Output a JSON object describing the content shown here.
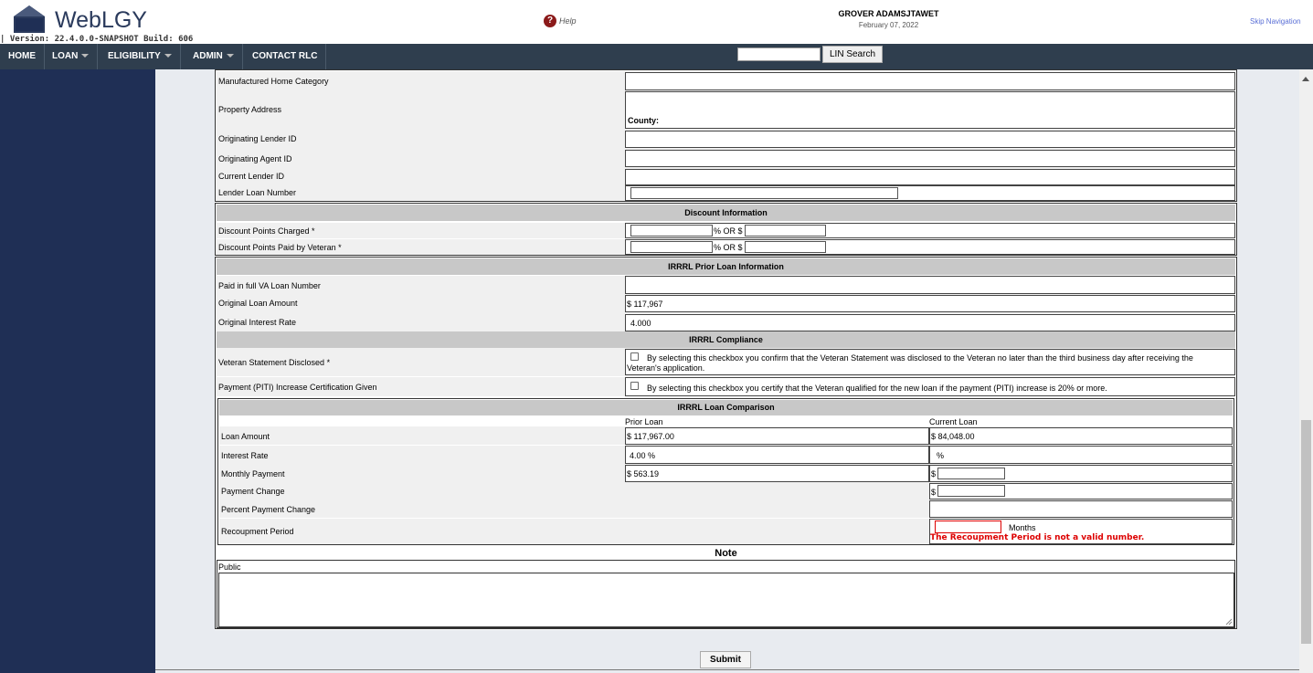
{
  "header": {
    "logo_text": "WebLGY",
    "version": "| Version: 22.4.0.0-SNAPSHOT Build: 606",
    "help_label": "Help",
    "user_name": "GROVER ADAMSJTAWET",
    "date": "February 07, 2022",
    "skip_nav": "Skip Navigation"
  },
  "nav": {
    "items": [
      "HOME",
      "LOAN",
      "ELIGIBILITY",
      "ADMIN",
      "CONTACT RLC"
    ],
    "search_button": "LIN Search"
  },
  "loan_info": {
    "manufactured_home_category": "Manufactured Home Category",
    "property_address": "Property Address",
    "county_label": "County:",
    "originating_lender_id": "Originating Lender ID",
    "originating_agent_id": "Originating Agent ID",
    "current_lender_id": "Current Lender ID",
    "lender_loan_number": "Lender Loan Number"
  },
  "discount": {
    "title": "Discount Information",
    "points_charged": "Discount Points Charged *",
    "points_paid": "Discount Points Paid by Veteran *",
    "or_label": "% OR $"
  },
  "prior_loan": {
    "title": "IRRRL Prior Loan Information",
    "paid_in_full": "Paid in full VA Loan Number",
    "original_amount_label": "Original Loan Amount",
    "original_amount": "$ 117,967",
    "original_rate_label": "Original Interest Rate",
    "original_rate": "4.000"
  },
  "compliance": {
    "title": "IRRRL Compliance",
    "veteran_statement_label": "Veteran Statement Disclosed *",
    "veteran_statement_text_1": "By selecting this checkbox you confirm that the Veteran Statement was disclosed to the Veteran no later than the third business day after receiving the",
    "veteran_statement_text_2": "Veteran's application.",
    "piti_label": "Payment (PITI) Increase Certification Given",
    "piti_text": "By selecting this checkbox you certify that the Veteran qualified for the new loan if the payment (PITI) increase is 20% or more."
  },
  "comparison": {
    "title": "IRRRL Loan Comparison",
    "prior_header": "Prior Loan",
    "current_header": "Current Loan",
    "loan_amount_label": "Loan Amount",
    "prior_amount": "$ 117,967.00",
    "current_amount": "$ 84,048.00",
    "interest_rate_label": "Interest Rate",
    "prior_rate": "4.00 %",
    "current_rate": "%",
    "monthly_payment_label": "Monthly Payment",
    "prior_payment": "$ 563.19",
    "dollar": "$",
    "payment_change_label": "Payment Change",
    "percent_change_label": "Percent Payment Change",
    "recoupment_label": "Recoupment Period",
    "months_label": "Months",
    "error": "The Recoupment Period is not a valid number."
  },
  "note": {
    "title": "Note",
    "public_label": "Public"
  },
  "submit_label": "Submit"
}
